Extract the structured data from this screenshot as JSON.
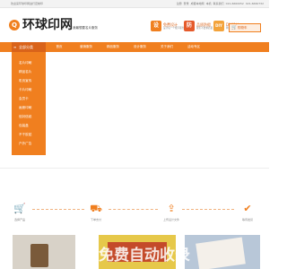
{
  "topbar": {
    "welcome": "欢迎来环球印网进行定制印",
    "links": [
      "注册",
      "登录",
      "成都本地网",
      "本机",
      "联系我们",
      "021-6660052",
      "021-6660732"
    ]
  },
  "logo": {
    "mark": "Q",
    "text": "环球印网",
    "slogan": "我最想要名片服务"
  },
  "features": [
    {
      "icon": "设",
      "title": "免费设计",
      "sub": "设计每一个细节服务",
      "color": "#f07f1f"
    },
    {
      "icon": "防",
      "title": "品质防假",
      "sub": "我们不要求质量",
      "color": "#e55a2b"
    },
    {
      "icon": "DIY",
      "title": "DIY设计",
      "sub": "网站支持网络平台",
      "color": "#f3a33b"
    }
  ],
  "cart": {
    "icon": "cart-icon",
    "label": "购物车"
  },
  "nav": {
    "category_label": "全部分类",
    "items": [
      "首页",
      "营销服务",
      "精品服务",
      "设计服务",
      "关于我们",
      "活动专区"
    ]
  },
  "sidebar": {
    "items": [
      "名片印刷",
      "精品名片",
      "彩页宣传",
      "卡片印刷",
      "会员卡",
      "画册印刷",
      "信封信纸",
      "包装盒",
      "不干胶贴",
      "户外广告"
    ]
  },
  "steps": [
    {
      "icon": "cart-icon",
      "label": "选择产品"
    },
    {
      "icon": "truck-icon",
      "label": "下单支付"
    },
    {
      "icon": "upload-icon",
      "label": "上传设计文件"
    },
    {
      "icon": "check-icon",
      "label": "等待发货"
    }
  ],
  "watermark": "免费自动收录",
  "colors": {
    "accent": "#f07f1f",
    "accent_dark": "#d9631a"
  }
}
